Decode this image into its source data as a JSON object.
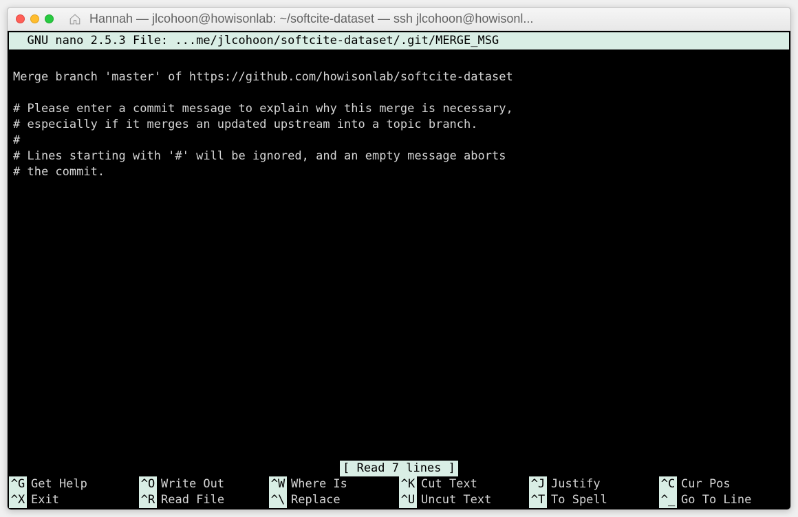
{
  "window": {
    "title": "Hannah — jlcohoon@howisonlab: ~/softcite-dataset — ssh jlcohoon@howisonl..."
  },
  "nano": {
    "header": "  GNU nano 2.5.3 File: ...me/jlcohoon/softcite-dataset/.git/MERGE_MSG           ",
    "status": "[ Read 7 lines ]"
  },
  "content": {
    "line1": "",
    "line2": "Merge branch 'master' of https://github.com/howisonlab/softcite-dataset",
    "line3": "",
    "line4": "# Please enter a commit message to explain why this merge is necessary,",
    "line5": "# especially if it merges an updated upstream into a topic branch.",
    "line6": "#",
    "line7": "# Lines starting with '#' will be ignored, and an empty message aborts",
    "line8": "# the commit."
  },
  "shortcuts": {
    "row1": [
      {
        "key": "^G",
        "label": "Get Help"
      },
      {
        "key": "^O",
        "label": "Write Out"
      },
      {
        "key": "^W",
        "label": "Where Is"
      },
      {
        "key": "^K",
        "label": "Cut Text"
      },
      {
        "key": "^J",
        "label": "Justify"
      },
      {
        "key": "^C",
        "label": "Cur Pos"
      }
    ],
    "row2": [
      {
        "key": "^X",
        "label": "Exit"
      },
      {
        "key": "^R",
        "label": "Read File"
      },
      {
        "key": "^\\",
        "label": "Replace"
      },
      {
        "key": "^U",
        "label": "Uncut Text"
      },
      {
        "key": "^T",
        "label": "To Spell"
      },
      {
        "key": "^_",
        "label": "Go To Line"
      }
    ]
  }
}
